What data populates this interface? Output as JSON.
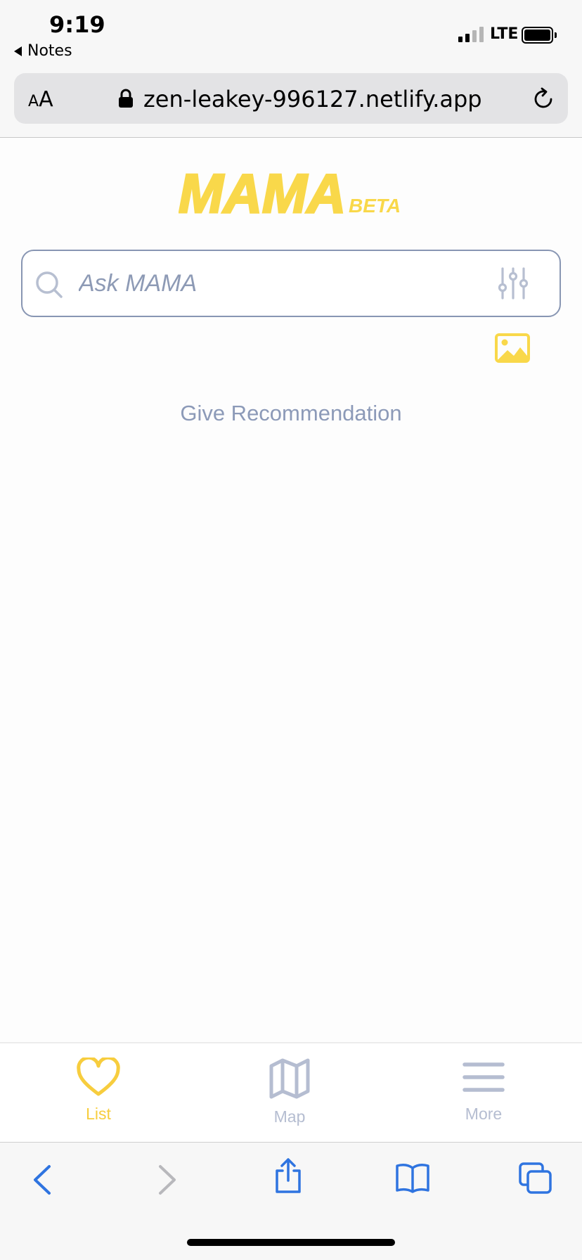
{
  "status_bar": {
    "time": "9:19",
    "back_app": "Notes",
    "network": "LTE",
    "signal_bars": 2,
    "signal_bars_total": 4
  },
  "browser": {
    "text_size_small": "A",
    "text_size_large": "A",
    "url": "zen-leakey-996127.netlify.app",
    "icons": [
      "lock-icon",
      "reload-icon"
    ]
  },
  "page": {
    "logo_text": "MAMA",
    "logo_badge": "BETA",
    "search_placeholder": "Ask MAMA",
    "give_recommendation": "Give Recommendation",
    "colors": {
      "brand_yellow": "#f9d84a",
      "accent_blue_gray": "#8c9ab8",
      "inactive_tab": "#b5bdd1"
    }
  },
  "tab_bar": {
    "tabs": [
      {
        "label": "List",
        "icon": "heart-icon",
        "active": true
      },
      {
        "label": "Map",
        "icon": "map-icon",
        "active": false
      },
      {
        "label": "More",
        "icon": "menu-icon",
        "active": false
      }
    ]
  },
  "safari_toolbar": {
    "buttons": [
      "back-icon",
      "forward-icon",
      "share-icon",
      "bookmarks-icon",
      "tabs-icon"
    ],
    "color": "#2f74e0"
  }
}
